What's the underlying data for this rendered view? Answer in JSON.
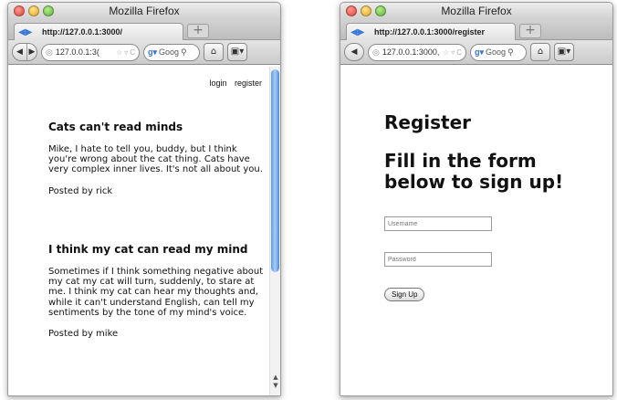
{
  "left_window": {
    "title": "Mozilla Firefox",
    "tab_label": "http://127.0.0.1:3000/",
    "new_tab": "+",
    "url": "127.0.0.1:3(",
    "search_placeholder": "Goog",
    "auth_links": {
      "login": "login",
      "register": "register"
    },
    "posts": [
      {
        "title": "Cats can't read minds",
        "body": "Mike, I hate to tell you, buddy, but I think you're wrong about the cat thing. Cats have very complex inner lives. It's not all about you.",
        "byline": "Posted by rick"
      },
      {
        "title": "I think my cat can read my mind",
        "body": "Sometimes if I think something negative about my cat my cat will turn, suddenly, to stare at me. I think my cat can hear my thoughts and, while it can't understand English, can tell my sentiments by the tone of my mind's voice.",
        "byline": "Posted by mike"
      }
    ]
  },
  "right_window": {
    "title": "Mozilla Firefox",
    "tab_label": "http://127.0.0.1:3000/register",
    "new_tab": "+",
    "url": "127.0.0.1:3000,",
    "search_placeholder": "Goog",
    "heading": "Register",
    "subheading": "Fill in the form below to sign up!",
    "username_placeholder": "Username",
    "password_placeholder": "Password",
    "submit_label": "Sign Up"
  },
  "icons": {
    "back": "back-arrow-icon",
    "forward": "forward-arrow-icon",
    "home": "home-icon",
    "reload": "reload-icon",
    "bookmark": "star-icon",
    "search": "magnifier-icon"
  },
  "colors": {
    "scroll_thumb": "#5d9ae8",
    "close_light": "#e0443a",
    "minimize_light": "#e6a624",
    "zoom_light": "#5cb43a"
  }
}
